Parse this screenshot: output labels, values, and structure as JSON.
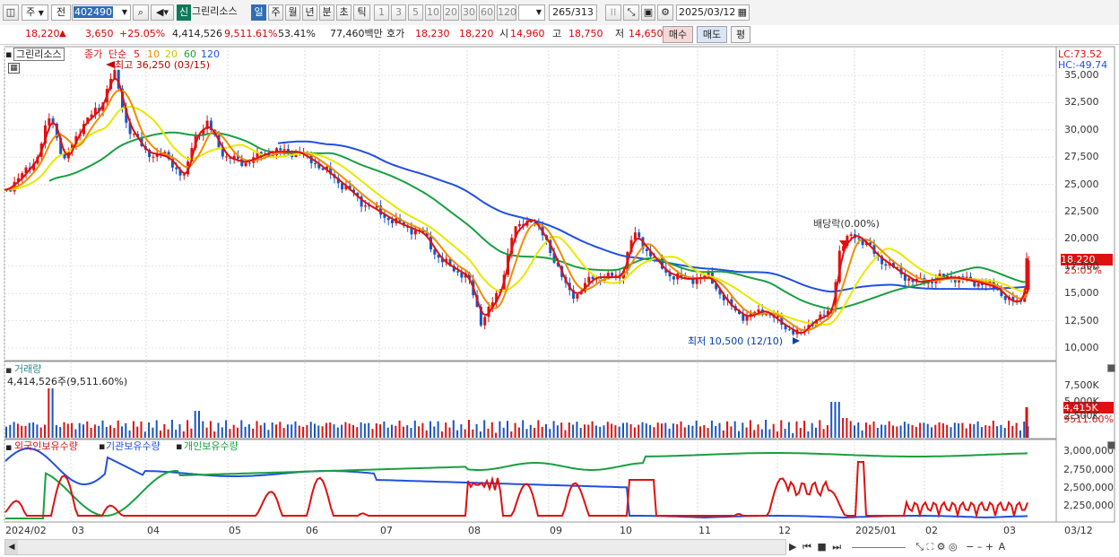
{
  "toolbar": {
    "period_type": "주",
    "adjust": "전",
    "code": "402490",
    "new_label": "신",
    "name": "그린리소스",
    "period_buttons": [
      "일",
      "주",
      "월",
      "년",
      "분",
      "초",
      "틱"
    ],
    "active_period": "일",
    "minute_buttons": [
      "1",
      "3",
      "5",
      "10",
      "20",
      "30",
      "60",
      "120"
    ],
    "count": "265",
    "total": "/313",
    "date": "2025/03/12"
  },
  "pricebar": {
    "price": "18,220",
    "change": "3,650",
    "change_pct": "+25.05%",
    "volume": "4,414,526",
    "volume_pct": "9,511.61%",
    "turnover_rate": "53.41%",
    "amount": "77,460백만",
    "ask_label": "호가",
    "ask": "18,230",
    "bid": "18,220",
    "open_label": "시",
    "open": "14,960",
    "high_label": "고",
    "high": "18,750",
    "low_label": "저",
    "low": "14,650",
    "buy_btn": "매수",
    "sell_btn": "매도",
    "eval_btn": "평"
  },
  "legend": {
    "name": "그린리소스",
    "price_type": "종가",
    "ma_type": "단순",
    "ma_periods": [
      "5",
      "10",
      "20",
      "60",
      "120"
    ],
    "ma_colors": [
      "#e01010",
      "#f08c00",
      "#e8e800",
      "#18a040",
      "#2050e0"
    ]
  },
  "annotations": {
    "high": "최고 36,250 (03/15)",
    "low": "최저 10,500 (12/10)",
    "dividend": "배당락(0.00%)",
    "lc": "LC:73.52",
    "hc": "HC:-49.74",
    "current_price": "18,220",
    "current_pct": "25.05%",
    "volume_title": "거래량",
    "volume_value": "4,414,526주(9,511.60%)",
    "volume_current": "4,415K",
    "volume_current_pct": "9511.60%",
    "holding_labels": [
      "외국인보유수량",
      "기관보유수량",
      "개인보유수량"
    ],
    "holding_colors": [
      "#e01010",
      "#2050e0",
      "#18a040"
    ]
  },
  "price_axis": [
    "35,000",
    "32,500",
    "30,000",
    "27,500",
    "25,000",
    "22,500",
    "20,000",
    "17,500",
    "15,000",
    "12,500",
    "10,000"
  ],
  "volume_axis": [
    "7,500K",
    "5,000K",
    "2,500K"
  ],
  "holding_axis": [
    "3,000,000",
    "2,750,000",
    "2,500,000",
    "2,250,000"
  ],
  "date_axis": [
    "2024/02",
    "03",
    "04",
    "05",
    "06",
    "07",
    "08",
    "09",
    "10",
    "11",
    "12",
    "2025/01",
    "02",
    "03"
  ],
  "date_axis_right": "03/12",
  "colors": {
    "up": "#e01010",
    "down": "#1a55c0",
    "accent": "#2f6db5"
  }
}
